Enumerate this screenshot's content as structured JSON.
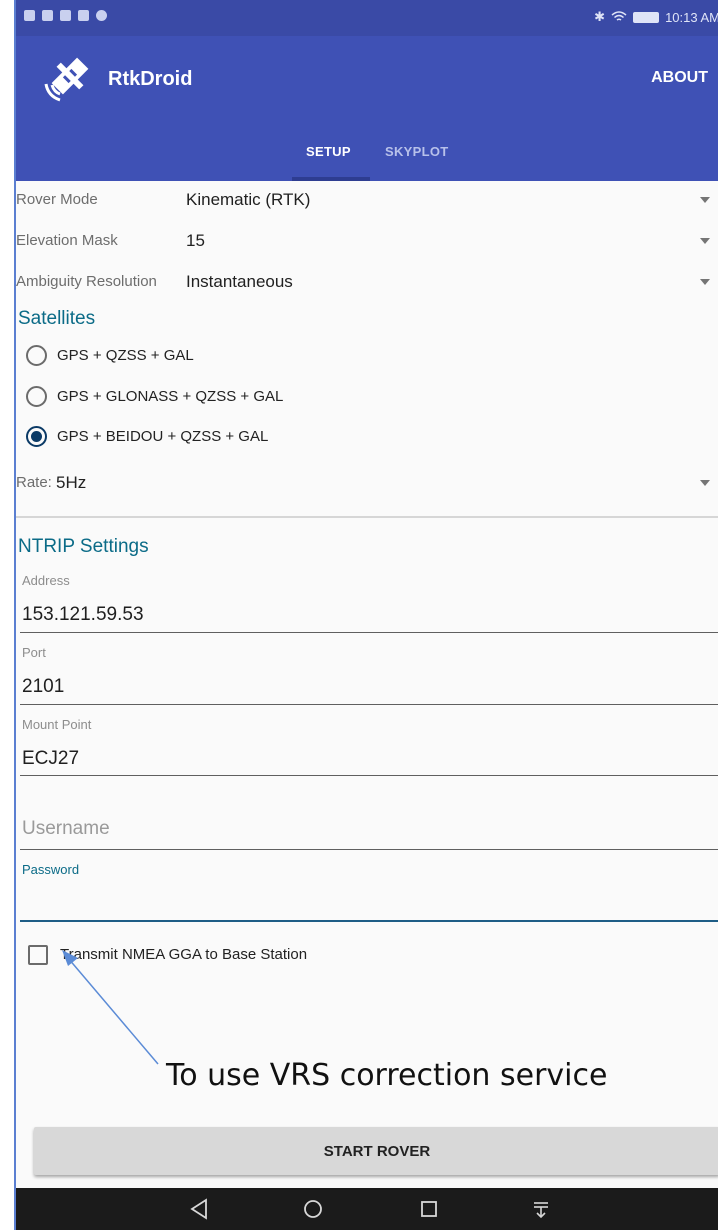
{
  "status_bar": {
    "time": "10:13 AM"
  },
  "app": {
    "title": "RtkDroid",
    "about_label": "ABOUT"
  },
  "tabs": [
    {
      "label": "SETUP",
      "active": true
    },
    {
      "label": "SKYPLOT",
      "active": false
    }
  ],
  "settings": {
    "rover_mode": {
      "label": "Rover Mode",
      "value": "Kinematic (RTK)"
    },
    "elevation_mask": {
      "label": "Elevation Mask",
      "value": "15"
    },
    "ambiguity_resolution": {
      "label": "Ambiguity Resolution",
      "value": "Instantaneous"
    }
  },
  "satellites": {
    "title": "Satellites",
    "options": [
      {
        "label": "GPS + QZSS + GAL",
        "selected": false
      },
      {
        "label": "GPS + GLONASS + QZSS + GAL",
        "selected": false
      },
      {
        "label": "GPS + BEIDOU + QZSS + GAL",
        "selected": true
      }
    ]
  },
  "rate": {
    "label": "Rate:",
    "value": "5Hz"
  },
  "ntrip": {
    "title": "NTRIP Settings",
    "address": {
      "label": "Address",
      "value": "153.121.59.53"
    },
    "port": {
      "label": "Port",
      "value": "2101"
    },
    "mount_point": {
      "label": "Mount Point",
      "value": "ECJ27"
    },
    "username": {
      "placeholder": "Username",
      "value": ""
    },
    "password": {
      "label": "Password",
      "value": ""
    }
  },
  "transmit_gga": {
    "label": "Transmit NMEA GGA to Base Station",
    "checked": false
  },
  "annotation": {
    "text": "To use VRS correction service"
  },
  "start_button": {
    "label": "START ROVER"
  },
  "colors": {
    "primary": "#3f51b5",
    "status_bar": "#3a4aa6",
    "accent": "#0b6b87"
  },
  "icons": [
    "satellite-icon",
    "back-icon",
    "home-icon",
    "recents-icon",
    "notification-pull-icon"
  ]
}
